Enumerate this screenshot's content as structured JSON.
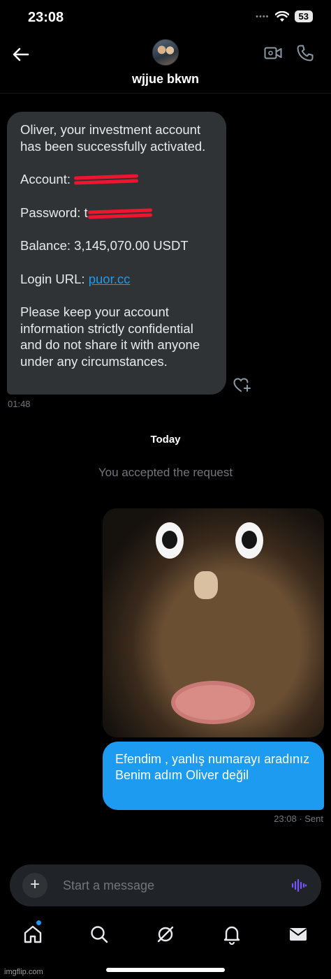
{
  "status_bar": {
    "time": "23:08",
    "signal": "••••",
    "battery": "53"
  },
  "header": {
    "contact_name": "wjjue bkwn"
  },
  "incoming_message": {
    "line1": "Oliver, your      investment account has been successfully activated.",
    "account_label": "Account: ",
    "password_label": "Password: t",
    "balance": "Balance: 3,145,070.00 USDT",
    "login_label": "Login URL: ",
    "login_link": "puor.cc",
    "closing": "Please keep your account information strictly confidential and do not share it with anyone under any circumstances.",
    "time": "01:48"
  },
  "day_separator": "Today",
  "system_note": "You accepted the request",
  "outgoing_message": {
    "line1": "Efendim , yanlış numarayı aradınız",
    "line2": "Benim adım Oliver değil",
    "time": "23:08",
    "status": "· Sent"
  },
  "composer": {
    "placeholder": "Start a message",
    "plus": "+"
  },
  "colors": {
    "accent": "#1d9bf0",
    "incoming_bubble": "#2f3336",
    "redaction": "#f0142f",
    "voice_icon": "#7856ff"
  },
  "nav": {
    "items": [
      "home-icon",
      "search-icon",
      "grok-icon",
      "notifications-icon",
      "messages-icon"
    ]
  },
  "watermark": "imgflip.com"
}
